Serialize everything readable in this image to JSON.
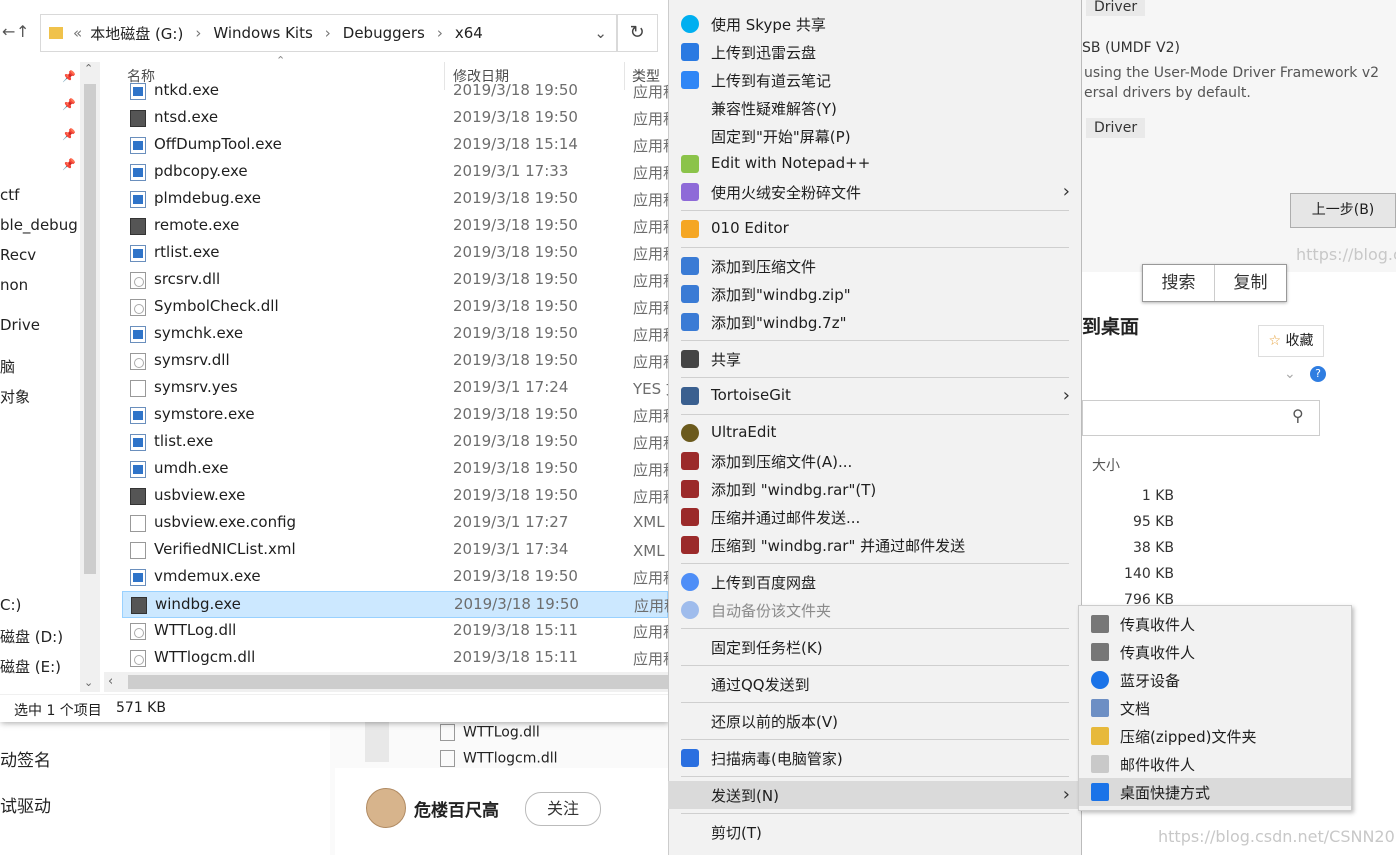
{
  "background": {
    "left_lines": [
      "动签名",
      "试驱动"
    ],
    "mid_files": [
      "WTTLog.dll",
      "WTTlogcm.dll"
    ],
    "author": {
      "name": "危楼百尺高",
      "follow_label": "关注"
    },
    "right_top": {
      "tag1": "Driver",
      "desc_title": "SB (UMDF V2)",
      "desc_line1": "using the User-Mode Driver Framework v2",
      "desc_line2": "ersal drivers by default.",
      "tag2": "Driver",
      "prev_button": "上一步(B)"
    },
    "search_label": "搜索",
    "copy_label": "复制",
    "heading_fragment": "到桌面",
    "favorite_label": "收藏",
    "size_header": "大小",
    "sizes": [
      "1 KB",
      "95 KB",
      "38 KB",
      "140 KB",
      "796 KB"
    ],
    "watermark_top": "https://blog.c",
    "watermark_bottom": "https://blog.csdn.net/CSNN2019"
  },
  "explorer": {
    "breadcrumb": [
      "本地磁盘 (G:)",
      "Windows Kits",
      "Debuggers",
      "x64"
    ],
    "nav_items": [
      "ctf",
      "ble_debug",
      "Recv",
      "non",
      "Drive",
      "脑",
      "对象",
      "C:)",
      "磁盘 (D:)",
      "磁盘 (E:)"
    ],
    "columns": {
      "name": "名称",
      "date": "修改日期",
      "type": "类型"
    },
    "files": [
      {
        "name": "ntkd.exe",
        "date": "2019/3/18 19:50",
        "type": "应用程",
        "icon": "exe"
      },
      {
        "name": "ntsd.exe",
        "date": "2019/3/18 19:50",
        "type": "应用程",
        "icon": "special"
      },
      {
        "name": "OffDumpTool.exe",
        "date": "2019/3/18 15:14",
        "type": "应用程",
        "icon": "exe"
      },
      {
        "name": "pdbcopy.exe",
        "date": "2019/3/1 17:33",
        "type": "应用程",
        "icon": "exe"
      },
      {
        "name": "plmdebug.exe",
        "date": "2019/3/18 19:50",
        "type": "应用程",
        "icon": "exe"
      },
      {
        "name": "remote.exe",
        "date": "2019/3/18 19:50",
        "type": "应用程",
        "icon": "special"
      },
      {
        "name": "rtlist.exe",
        "date": "2019/3/18 19:50",
        "type": "应用程",
        "icon": "exe"
      },
      {
        "name": "srcsrv.dll",
        "date": "2019/3/18 19:50",
        "type": "应用程",
        "icon": "dll"
      },
      {
        "name": "SymbolCheck.dll",
        "date": "2019/3/18 19:50",
        "type": "应用程",
        "icon": "dll"
      },
      {
        "name": "symchk.exe",
        "date": "2019/3/18 19:50",
        "type": "应用程",
        "icon": "exe"
      },
      {
        "name": "symsrv.dll",
        "date": "2019/3/18 19:50",
        "type": "应用程",
        "icon": "dll"
      },
      {
        "name": "symsrv.yes",
        "date": "2019/3/1 17:24",
        "type": "YES 文",
        "icon": "file"
      },
      {
        "name": "symstore.exe",
        "date": "2019/3/18 19:50",
        "type": "应用程",
        "icon": "exe"
      },
      {
        "name": "tlist.exe",
        "date": "2019/3/18 19:50",
        "type": "应用程",
        "icon": "exe"
      },
      {
        "name": "umdh.exe",
        "date": "2019/3/18 19:50",
        "type": "应用程",
        "icon": "exe"
      },
      {
        "name": "usbview.exe",
        "date": "2019/3/18 19:50",
        "type": "应用程",
        "icon": "special"
      },
      {
        "name": "usbview.exe.config",
        "date": "2019/3/1 17:27",
        "type": "XML C",
        "icon": "file"
      },
      {
        "name": "VerifiedNICList.xml",
        "date": "2019/3/1 17:34",
        "type": "XML 文",
        "icon": "file"
      },
      {
        "name": "vmdemux.exe",
        "date": "2019/3/18 19:50",
        "type": "应用程",
        "icon": "exe"
      },
      {
        "name": "windbg.exe",
        "date": "2019/3/18 19:50",
        "type": "应用程",
        "icon": "special",
        "selected": true
      },
      {
        "name": "WTTLog.dll",
        "date": "2019/3/18 15:11",
        "type": "应用程",
        "icon": "dll"
      },
      {
        "name": "WTTlogcm.dll",
        "date": "2019/3/18 15:11",
        "type": "应用程",
        "icon": "dll"
      }
    ],
    "status": {
      "selection": "选中 1 个项目",
      "size": "571 KB"
    }
  },
  "context_menu": {
    "items": [
      {
        "label": "使用 Skype 共享",
        "icon": "skype-icon",
        "color": "#00aff0"
      },
      {
        "label": "上传到迅雷云盘",
        "icon": "thunder-icon",
        "color": "#2a7ae2"
      },
      {
        "label": "上传到有道云笔记",
        "icon": "youdao-icon",
        "color": "#2f86f6"
      },
      {
        "label": "兼容性疑难解答(Y)",
        "icon": "",
        "color": ""
      },
      {
        "label": "固定到\"开始\"屏幕(P)",
        "icon": "",
        "color": ""
      },
      {
        "label": "Edit with Notepad++",
        "icon": "notepad-icon",
        "color": "#8bc34a"
      },
      {
        "label": "使用火绒安全粉碎文件",
        "icon": "huorong-icon",
        "color": "#8e6ad8",
        "submenu": true
      },
      {
        "label": "010 Editor",
        "icon": "editor-icon",
        "color": "#f5a623",
        "sep_before": true
      },
      {
        "label": "添加到压缩文件",
        "icon": "zip-icon",
        "color": "#3a7bd5",
        "sep_before": true
      },
      {
        "label": "添加到\"windbg.zip\"",
        "icon": "zip-icon",
        "color": "#3a7bd5"
      },
      {
        "label": "添加到\"windbg.7z\"",
        "icon": "zip-icon",
        "color": "#3a7bd5"
      },
      {
        "label": "共享",
        "icon": "share-icon",
        "color": "#444444",
        "sep_before": true
      },
      {
        "label": "TortoiseGit",
        "icon": "tortoise-icon",
        "color": "#3a5f8f",
        "submenu": true,
        "sep_before": true
      },
      {
        "label": "UltraEdit",
        "icon": "ultraedit-icon",
        "color": "#6b5a1d",
        "sep_before": true
      },
      {
        "label": "添加到压缩文件(A)...",
        "icon": "winrar-icon",
        "color": "#9b2a2a"
      },
      {
        "label": "添加到 \"windbg.rar\"(T)",
        "icon": "winrar-icon",
        "color": "#9b2a2a"
      },
      {
        "label": "压缩并通过邮件发送...",
        "icon": "winrar-icon",
        "color": "#9b2a2a"
      },
      {
        "label": "压缩到 \"windbg.rar\" 并通过邮件发送",
        "icon": "winrar-icon",
        "color": "#9b2a2a"
      },
      {
        "label": "上传到百度网盘",
        "icon": "baidu-icon",
        "color": "#4e8ef7",
        "sep_before": true
      },
      {
        "label": "自动备份该文件夹",
        "icon": "baidu-icon",
        "color": "#9fbcec",
        "disabled": true
      },
      {
        "label": "固定到任务栏(K)",
        "icon": "",
        "color": "",
        "sep_before": true
      },
      {
        "label": "通过QQ发送到",
        "icon": "",
        "color": "",
        "sep_before": true
      },
      {
        "label": "还原以前的版本(V)",
        "icon": "",
        "color": "",
        "sep_before": true
      },
      {
        "label": "扫描病毒(电脑管家)",
        "icon": "tencent-shield-icon",
        "color": "#2a6fe0",
        "sep_before": true
      },
      {
        "label": "发送到(N)",
        "icon": "",
        "color": "",
        "submenu": true,
        "highlighted": true,
        "sep_before": true
      },
      {
        "label": "剪切(T)",
        "icon": "",
        "color": "",
        "sep_before": true
      }
    ]
  },
  "send_to_menu": {
    "items": [
      {
        "label": "传真收件人",
        "icon": "fax-icon"
      },
      {
        "label": "传真收件人",
        "icon": "fax-icon"
      },
      {
        "label": "蓝牙设备",
        "icon": "bluetooth-icon"
      },
      {
        "label": "文档",
        "icon": "document-icon"
      },
      {
        "label": "压缩(zipped)文件夹",
        "icon": "zip-folder-icon"
      },
      {
        "label": "邮件收件人",
        "icon": "mail-icon"
      },
      {
        "label": "桌面快捷方式",
        "icon": "desktop-icon",
        "highlighted": true
      }
    ]
  }
}
